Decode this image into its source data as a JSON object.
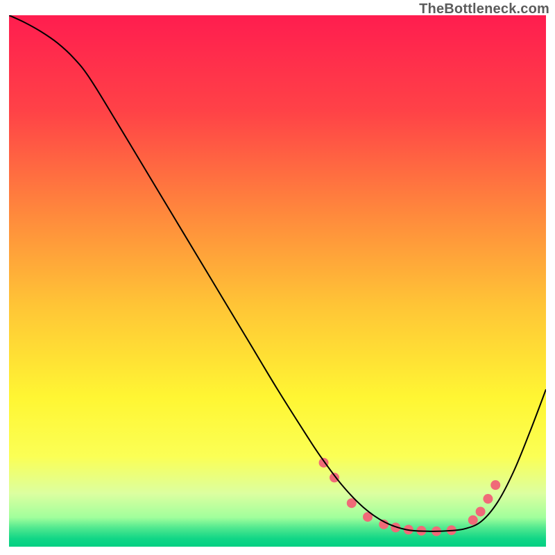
{
  "watermark": "TheBottleneck.com",
  "chart_data": {
    "type": "line",
    "title": "",
    "xlabel": "",
    "ylabel": "",
    "xlim": [
      0,
      100
    ],
    "ylim": [
      0,
      100
    ],
    "grid": false,
    "legend": false,
    "note": "Values estimated from pixel positions; no axis ticks are visible.",
    "background_gradient": {
      "stops": [
        {
          "offset": 0.0,
          "color": "#ff1d4f"
        },
        {
          "offset": 0.18,
          "color": "#ff4247"
        },
        {
          "offset": 0.38,
          "color": "#ff8b3c"
        },
        {
          "offset": 0.55,
          "color": "#ffc636"
        },
        {
          "offset": 0.72,
          "color": "#fff633"
        },
        {
          "offset": 0.83,
          "color": "#fbff55"
        },
        {
          "offset": 0.9,
          "color": "#dcffa0"
        },
        {
          "offset": 0.945,
          "color": "#a1ff9c"
        },
        {
          "offset": 0.965,
          "color": "#4fe88f"
        },
        {
          "offset": 0.985,
          "color": "#11d686"
        },
        {
          "offset": 1.0,
          "color": "#02cf82"
        }
      ]
    },
    "series": [
      {
        "name": "curve",
        "stroke": "#000000",
        "stroke_width": 2,
        "x": [
          0.0,
          3.0,
          6.0,
          9.0,
          12.0,
          15.0,
          20.0,
          25.0,
          30.0,
          35.0,
          40.0,
          45.0,
          50.0,
          55.0,
          58.0,
          62.0,
          66.0,
          70.0,
          74.0,
          78.0,
          82.0,
          85.0,
          88.0,
          91.0,
          94.0,
          97.0,
          100.0
        ],
        "y": [
          100.0,
          98.6,
          96.9,
          94.8,
          92.0,
          88.2,
          80.0,
          71.6,
          63.2,
          54.8,
          46.4,
          38.0,
          29.6,
          21.6,
          17.0,
          11.6,
          7.4,
          4.6,
          3.2,
          2.9,
          3.0,
          3.4,
          4.8,
          8.4,
          14.2,
          21.6,
          29.6
        ]
      }
    ],
    "markers": {
      "name": "optimal-band-markers",
      "color": "#f06a78",
      "radius": 7,
      "points": [
        {
          "x": 58.6,
          "y": 15.8
        },
        {
          "x": 60.6,
          "y": 13.0
        },
        {
          "x": 63.8,
          "y": 8.2
        },
        {
          "x": 66.8,
          "y": 5.6
        },
        {
          "x": 69.8,
          "y": 4.2
        },
        {
          "x": 72.0,
          "y": 3.6
        },
        {
          "x": 74.4,
          "y": 3.2
        },
        {
          "x": 76.8,
          "y": 3.0
        },
        {
          "x": 79.6,
          "y": 2.9
        },
        {
          "x": 82.4,
          "y": 3.1
        },
        {
          "x": 86.4,
          "y": 5.0
        },
        {
          "x": 87.8,
          "y": 6.6
        },
        {
          "x": 89.2,
          "y": 9.0
        },
        {
          "x": 90.6,
          "y": 11.6
        }
      ]
    }
  }
}
